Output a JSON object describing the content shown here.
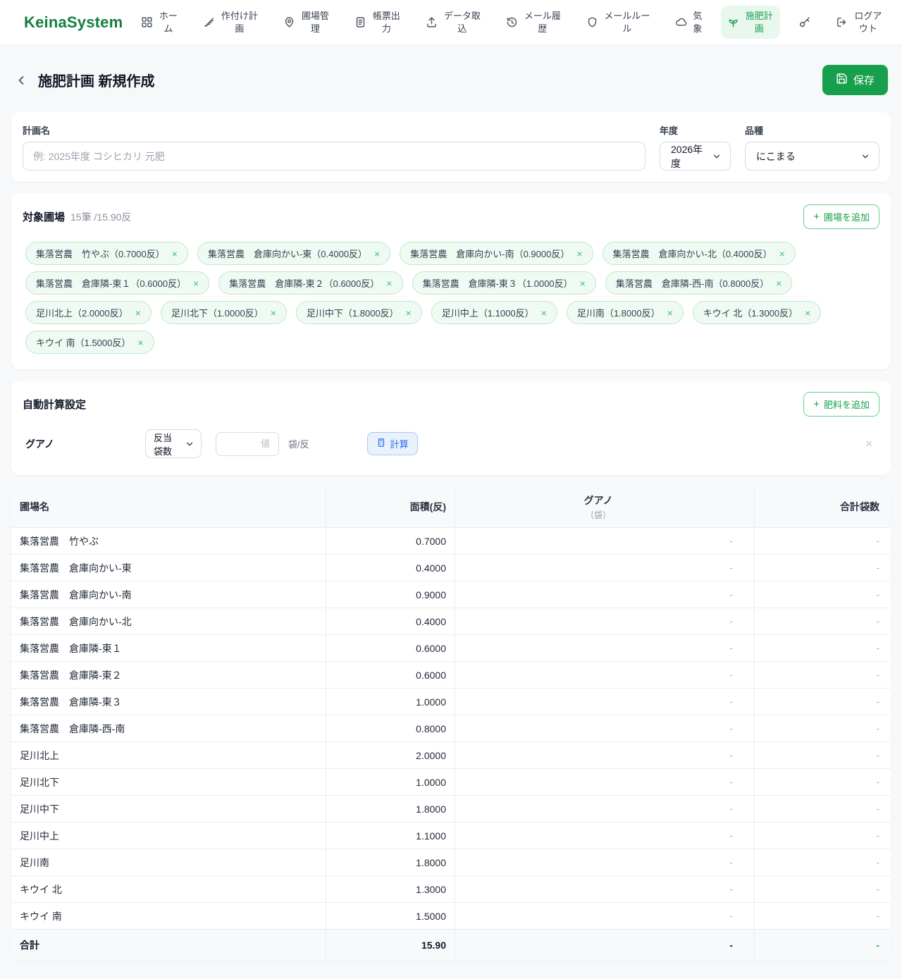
{
  "brand": "KeinaSystem",
  "icons_text": {
    "plus": "+",
    "close": "×"
  },
  "colors": {
    "accent_green": "#17a04b",
    "active_nav_bg": "#e9f8ef",
    "tag_bg": "#effaf3",
    "tag_border": "#bce9cd",
    "calc_blue": "#2b6de8"
  },
  "nav": {
    "items": [
      {
        "label": "ホーム",
        "icon": "grid-icon",
        "active": false
      },
      {
        "label": "作付け計画",
        "icon": "wheat-icon",
        "active": false
      },
      {
        "label": "圃場管理",
        "icon": "map-pin-icon",
        "active": false
      },
      {
        "label": "帳票出力",
        "icon": "document-icon",
        "active": false
      },
      {
        "label": "データ取込",
        "icon": "upload-icon",
        "active": false
      },
      {
        "label": "メール履歴",
        "icon": "history-icon",
        "active": false
      },
      {
        "label": "メールルール",
        "icon": "shield-icon",
        "active": false
      },
      {
        "label": "気象",
        "icon": "cloud-icon",
        "active": false
      },
      {
        "label": "施肥計画",
        "icon": "seedling-icon",
        "active": true
      }
    ],
    "logout_label": "ログアウト"
  },
  "header": {
    "title": "施肥計画 新規作成",
    "save_label": "保存"
  },
  "plan_form": {
    "name_label": "計画名",
    "name_placeholder": "例: 2025年度 コシヒカリ 元肥",
    "year_label": "年度",
    "year_value": "2026年度",
    "variety_label": "品種",
    "variety_value": "にこまる"
  },
  "fields_section": {
    "title": "対象圃場",
    "summary": "15筆 /15.90反",
    "add_button_label": "圃場を追加",
    "tags": [
      "集落営農　竹やぶ（0.7000反）",
      "集落営農　倉庫向かい-東（0.4000反）",
      "集落営農　倉庫向かい-南（0.9000反）",
      "集落営農　倉庫向かい-北（0.4000反）",
      "集落営農　倉庫隣-東１（0.6000反）",
      "集落営農　倉庫隣-東２（0.6000反）",
      "集落営農　倉庫隣-東３（1.0000反）",
      "集落営農　倉庫隣-西-南（0.8000反）",
      "足川北上（2.0000反）",
      "足川北下（1.0000反）",
      "足川中下（1.8000反）",
      "足川中上（1.1000反）",
      "足川南（1.8000反）",
      "キウイ 北（1.3000反）",
      "キウイ 南（1.5000反）"
    ]
  },
  "auto_calc": {
    "title": "自動計算設定",
    "add_button_label": "肥料を追加",
    "fertilizer_name": "グアノ",
    "method_value": "反当袋数",
    "value_placeholder": "値",
    "unit": "袋/反",
    "calc_button_label": "計算"
  },
  "table": {
    "headers": {
      "field": "圃場名",
      "area": "面積(反)",
      "fertilizer": "グアノ",
      "fertilizer_sub": "（袋）",
      "total": "合計袋数"
    },
    "rows": [
      {
        "name": "集落営農　竹やぶ",
        "area": "0.7000",
        "guano": "-",
        "total": "-"
      },
      {
        "name": "集落営農　倉庫向かい-東",
        "area": "0.4000",
        "guano": "-",
        "total": "-"
      },
      {
        "name": "集落営農　倉庫向かい-南",
        "area": "0.9000",
        "guano": "-",
        "total": "-"
      },
      {
        "name": "集落営農　倉庫向かい-北",
        "area": "0.4000",
        "guano": "-",
        "total": "-"
      },
      {
        "name": "集落営農　倉庫隣-東１",
        "area": "0.6000",
        "guano": "-",
        "total": "-"
      },
      {
        "name": "集落営農　倉庫隣-東２",
        "area": "0.6000",
        "guano": "-",
        "total": "-"
      },
      {
        "name": "集落営農　倉庫隣-東３",
        "area": "1.0000",
        "guano": "-",
        "total": "-"
      },
      {
        "name": "集落営農　倉庫隣-西-南",
        "area": "0.8000",
        "guano": "-",
        "total": "-"
      },
      {
        "name": "足川北上",
        "area": "2.0000",
        "guano": "-",
        "total": "-"
      },
      {
        "name": "足川北下",
        "area": "1.0000",
        "guano": "-",
        "total": "-"
      },
      {
        "name": "足川中下",
        "area": "1.8000",
        "guano": "-",
        "total": "-"
      },
      {
        "name": "足川中上",
        "area": "1.1000",
        "guano": "-",
        "total": "-"
      },
      {
        "name": "足川南",
        "area": "1.8000",
        "guano": "-",
        "total": "-"
      },
      {
        "name": "キウイ 北",
        "area": "1.3000",
        "guano": "-",
        "total": "-"
      },
      {
        "name": "キウイ 南",
        "area": "1.5000",
        "guano": "-",
        "total": "-"
      }
    ],
    "footer": {
      "name": "合計",
      "area": "15.90",
      "guano": "-",
      "total": "-"
    }
  }
}
